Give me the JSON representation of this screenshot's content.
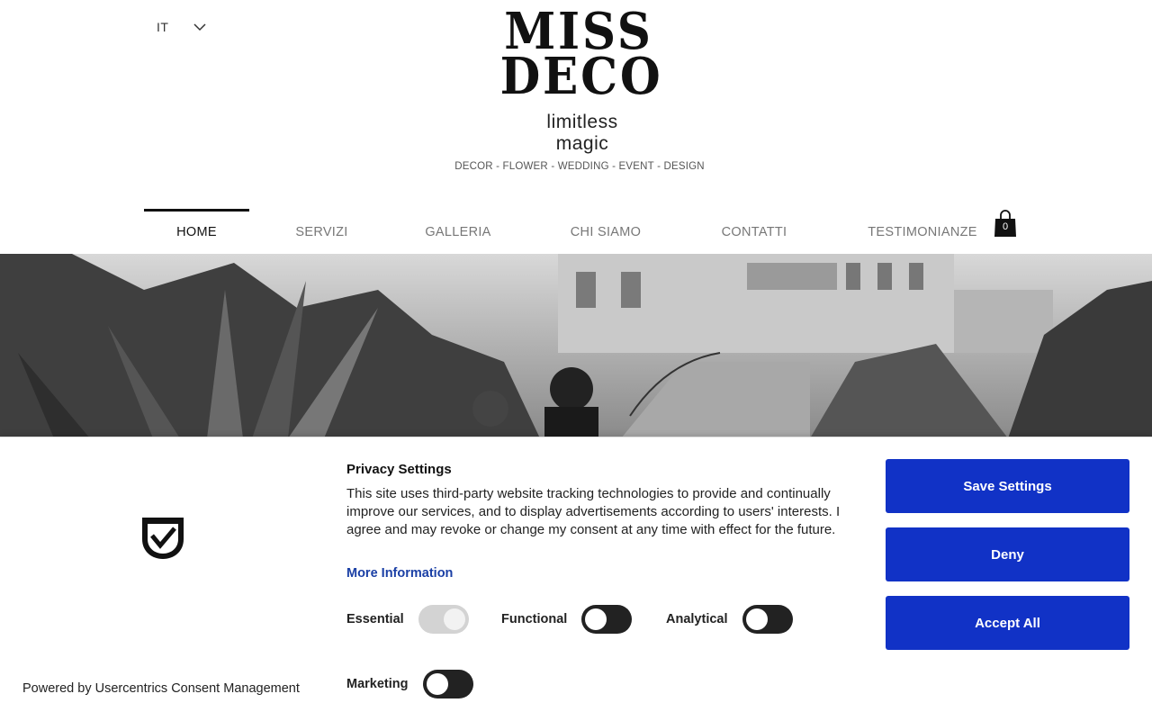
{
  "header": {
    "language": "IT",
    "logo_line1": "MISS",
    "logo_line2": "DECO",
    "tagline_line1": "limitless",
    "tagline_line2": "magic",
    "services_line": "DECOR - FLOWER - WEDDING - EVENT - DESIGN"
  },
  "nav": {
    "items": [
      {
        "label": "HOME",
        "active": true
      },
      {
        "label": "SERVIZI"
      },
      {
        "label": "GALLERIA"
      },
      {
        "label": "CHI SIAMO"
      },
      {
        "label": "CONTATTI"
      },
      {
        "label": "TESTIMONIANZE"
      }
    ],
    "cart_count": "0"
  },
  "consent": {
    "title": "Privacy Settings",
    "description": "This site uses third-party website tracking technologies to provide and continually improve our services, and to display advertisements according to users' interests. I agree and may revoke or change my consent at any time with effect for the future.",
    "more_info": "More Information",
    "toggles": [
      {
        "label": "Essential",
        "state": "on-disabled"
      },
      {
        "label": "Functional",
        "state": "off"
      },
      {
        "label": "Analytical",
        "state": "off"
      },
      {
        "label": "Marketing",
        "state": "off"
      }
    ],
    "buttons": {
      "save": "Save Settings",
      "deny": "Deny",
      "accept": "Accept All"
    },
    "powered_by": "Powered by Usercentrics Consent Management",
    "colors": {
      "button": "#1132c6",
      "link": "#1a3fa5"
    }
  }
}
